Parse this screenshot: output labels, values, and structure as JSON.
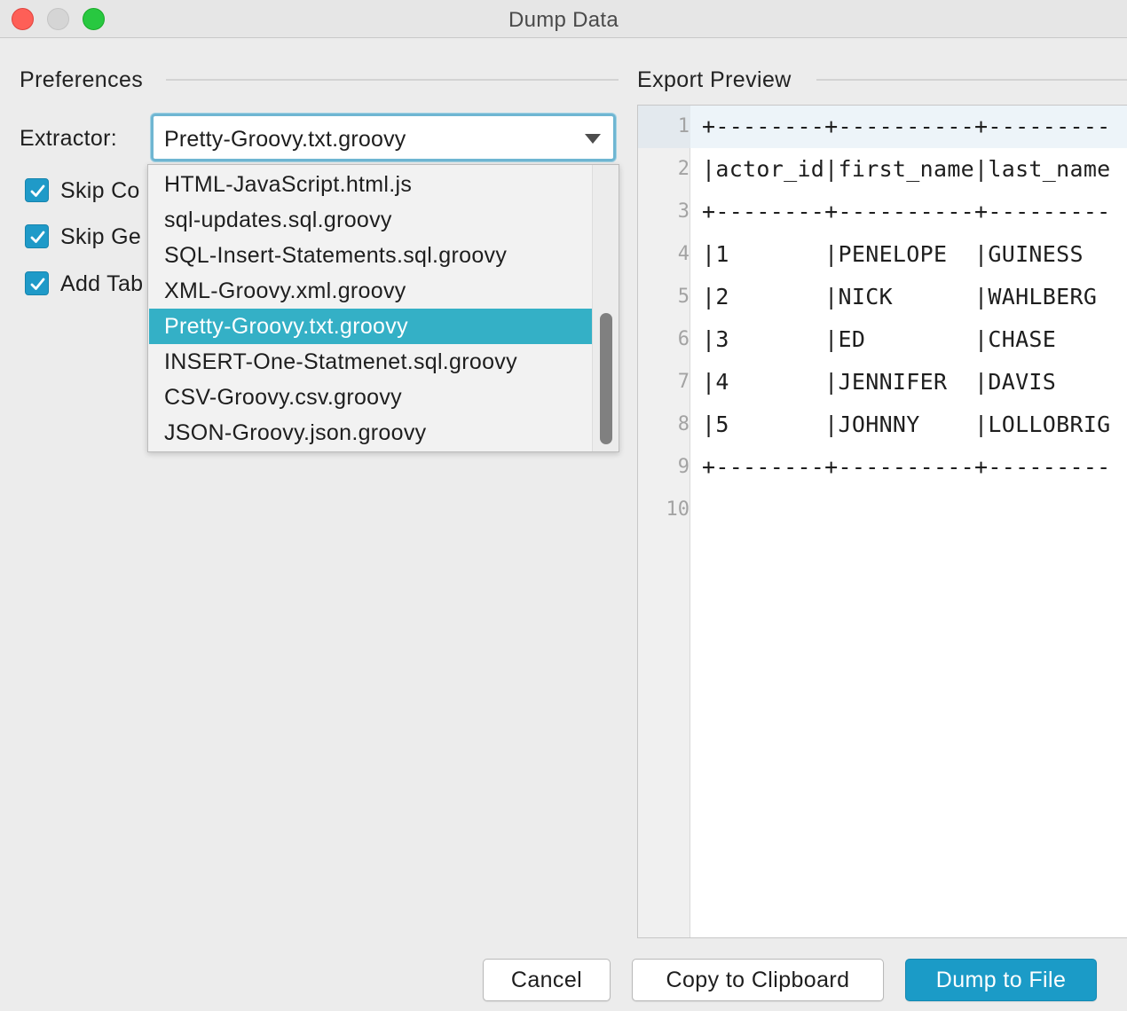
{
  "window": {
    "title": "Dump Data"
  },
  "preferences": {
    "title": "Preferences",
    "extractor_label": "Extractor:",
    "extractor_value": "Pretty-Groovy.txt.groovy",
    "checkboxes": [
      {
        "label": "Skip Co",
        "checked": true
      },
      {
        "label": "Skip Ge",
        "checked": true
      },
      {
        "label": "Add Tab",
        "checked": true
      }
    ]
  },
  "dropdown": {
    "options": [
      "HTML-JavaScript.html.js",
      "sql-updates.sql.groovy",
      "SQL-Insert-Statements.sql.groovy",
      "XML-Groovy.xml.groovy",
      "Pretty-Groovy.txt.groovy",
      "INSERT-One-Statmenet.sql.groovy",
      "CSV-Groovy.csv.groovy",
      "JSON-Groovy.json.groovy"
    ],
    "selected_index": 4
  },
  "preview": {
    "title": "Export Preview",
    "line_numbers": [
      "1",
      "2",
      "3",
      "4",
      "5",
      "6",
      "7",
      "8",
      "9",
      "10"
    ],
    "lines": [
      "+--------+----------+---------",
      "|actor_id|first_name|last_name",
      "+--------+----------+---------",
      "|1       |PENELOPE  |GUINESS",
      "|2       |NICK      |WAHLBERG",
      "|3       |ED        |CHASE",
      "|4       |JENNIFER  |DAVIS",
      "|5       |JOHNNY    |LOLLOBRIG",
      "+--------+----------+---------",
      ""
    ]
  },
  "buttons": {
    "cancel": "Cancel",
    "copy": "Copy to Clipboard",
    "dump": "Dump to File"
  },
  "colors": {
    "accent": "#1b9bc7",
    "selection": "#34b0c6",
    "checkbox": "#1f9ac8"
  }
}
